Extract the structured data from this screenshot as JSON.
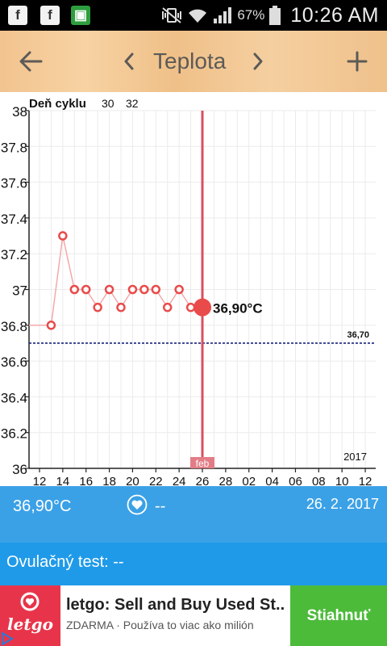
{
  "status_bar": {
    "battery": "67%",
    "time": "10:26 AM"
  },
  "toolbar": {
    "title": "Teplota"
  },
  "chart_data": {
    "type": "line",
    "x_title": "Deň cyklu",
    "cycle_day_labels": [
      "30",
      "32"
    ],
    "ylim": [
      36,
      38
    ],
    "y_ticks": [
      "36",
      "36.2",
      "36.4",
      "36.6",
      "36.8",
      "37",
      "37.2",
      "37.4",
      "37.6",
      "37.8",
      "38"
    ],
    "x_ticks": [
      "12",
      "14",
      "16",
      "18",
      "20",
      "22",
      "24",
      "26",
      "28",
      "02",
      "04",
      "06",
      "08",
      "10",
      "12"
    ],
    "series": [
      {
        "x": [
          "13",
          "14",
          "15",
          "16",
          "17",
          "18",
          "19",
          "20",
          "21",
          "22",
          "23",
          "24",
          "25",
          "26"
        ],
        "values": [
          36.8,
          37.3,
          37.0,
          37.0,
          36.9,
          37.0,
          36.9,
          37.0,
          37.0,
          37.0,
          36.9,
          37.0,
          36.9,
          36.9
        ]
      }
    ],
    "baseline_value": 36.7,
    "baseline_label": "36,70",
    "selected_x": "26",
    "selected_label": "36,90°C",
    "month_marker": "feb",
    "year_label": "2017",
    "grid": true,
    "colors": {
      "line": "#f08a8a",
      "point": "#e94b4b",
      "marker": "#d9505f",
      "baseline": "#1a237e"
    }
  },
  "info": {
    "temperature": "36,90°C",
    "heart_value": "--",
    "date": "26. 2. 2017",
    "ovulation_test": "Ovulačný test: --"
  },
  "ad": {
    "logo_text": "letgo",
    "title": "letgo: Sell and Buy Used St...",
    "subtitle": "ZDARMA · Používa to viac ako milión",
    "cta": "Stiahnuť"
  },
  "colors": {
    "toolbar": "#f2c48f",
    "info_blue": "#3ba1e6",
    "ovul_blue": "#1f9ae8",
    "ad_cta": "#4cbb3a",
    "ad_logo": "#e8344a"
  }
}
